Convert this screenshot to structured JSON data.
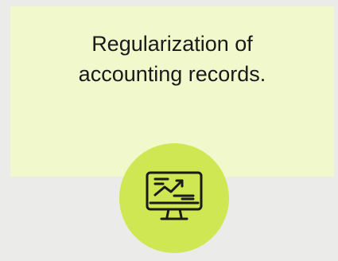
{
  "card": {
    "title_line1": "Regularization of",
    "title_line2": "accounting records.",
    "icon": "monitor-trend-chart-icon"
  },
  "colors": {
    "background": "#ebebea",
    "card_background": "#f1f8cc",
    "icon_circle": "#cee753",
    "icon_stroke": "#1a1a1a",
    "text": "#1a1a1a"
  }
}
